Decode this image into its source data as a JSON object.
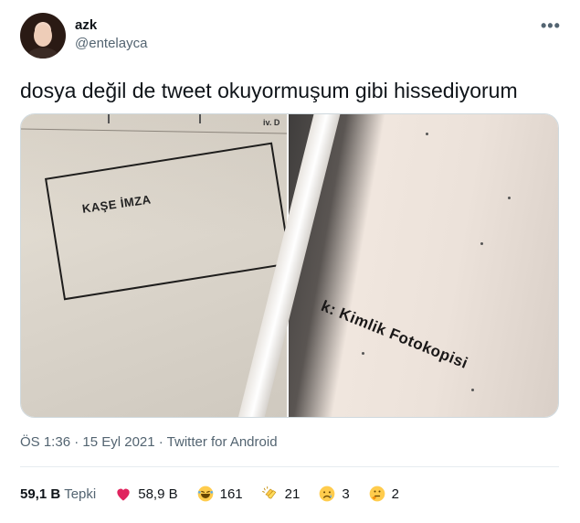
{
  "user": {
    "name": "azk",
    "handle": "@entelayca"
  },
  "more_icon": "•••",
  "tweet_text": "dosya değil de tweet okuyormuşum gibi hissediyorum",
  "media": {
    "photo1_stamp_text": "KAŞE İMZA",
    "photo1_corner_text": "iv. D",
    "photo2_text": "k: Kimlik Fotokopisi"
  },
  "meta": {
    "timestamp": "ÖS 1:36 · 15 Eyl 2021 · Twitter for Android"
  },
  "stats": {
    "reactions_count": "59,1 B",
    "reactions_label": "Tepki",
    "heart_count": "58,9 B",
    "laugh_count": "161",
    "clap_count": "21",
    "sad_count": "3",
    "think_count": "2"
  },
  "icons": {
    "heart": "heart-icon",
    "laugh": "laughing-emoji-icon",
    "clap": "clapping-emoji-icon",
    "sad": "crying-emoji-icon",
    "think": "thinking-emoji-icon"
  },
  "colors": {
    "text": "#0f1419",
    "muted": "#536471",
    "border": "#cfd9de",
    "heart": "#e0245e",
    "emoji_yellow": "#ffcc4d"
  }
}
